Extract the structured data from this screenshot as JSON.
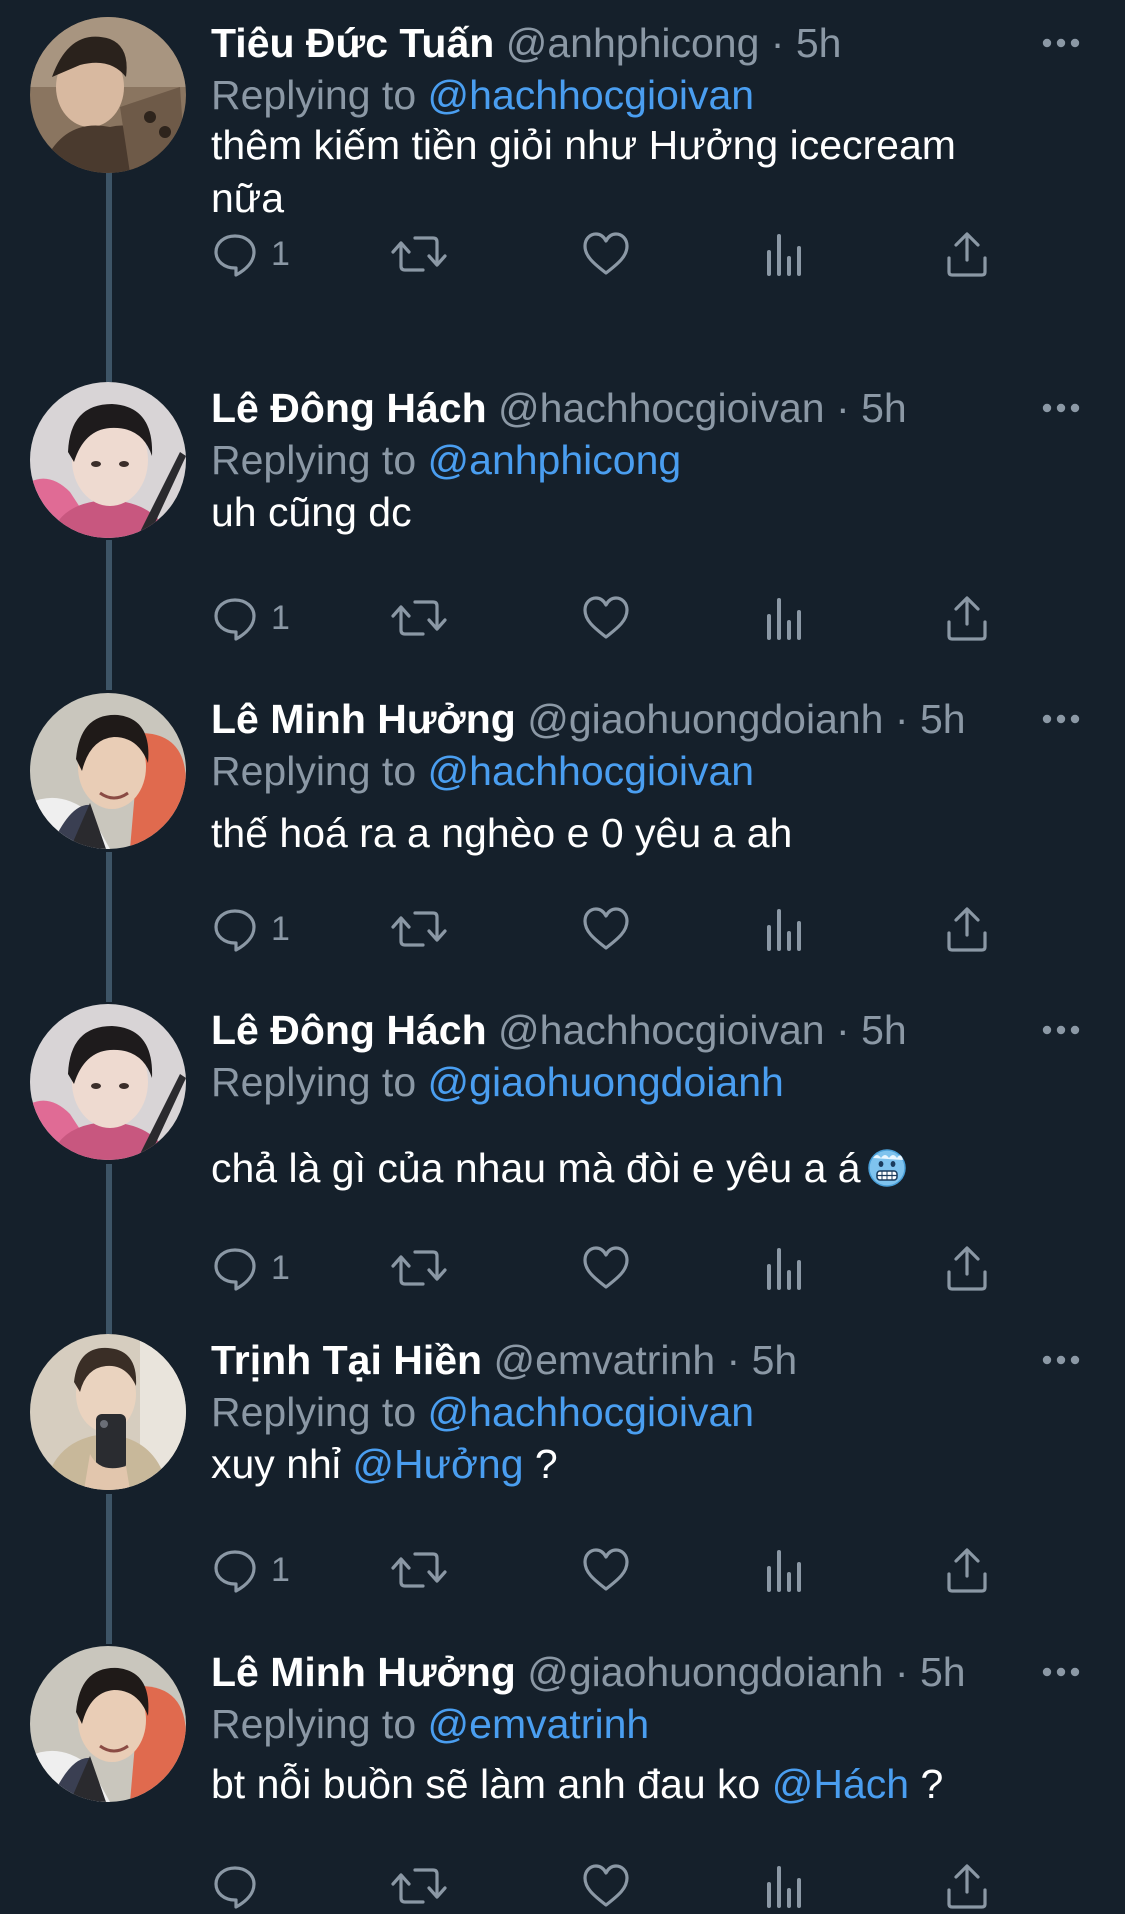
{
  "tweets": [
    {
      "name": "Tiêu Đức Tuấn",
      "handle": "@anhphicong",
      "sep": "·",
      "time": "5h",
      "replying_label": "Replying to",
      "replying_to": "@hachhocgioivan",
      "text_line1": "thêm kiếm tiền giỏi như Hưởng icecream",
      "text_line2": "nữa",
      "reply_count": "1"
    },
    {
      "name": "Lê Đông Hách",
      "handle": "@hachhocgioivan",
      "sep": "·",
      "time": "5h",
      "replying_label": "Replying to",
      "replying_to": "@anhphicong",
      "text": "uh cũng dc",
      "reply_count": "1"
    },
    {
      "name": "Lê Minh Hưởng",
      "handle": "@giaohuongdoianh",
      "sep": "·",
      "time": "5h",
      "replying_label": "Replying to",
      "replying_to": "@hachhocgioivan",
      "text": "thế hoá ra a nghèo e 0 yêu a ah",
      "reply_count": "1"
    },
    {
      "name": "Lê Đông Hách",
      "handle": "@hachhocgioivan",
      "sep": "·",
      "time": "5h",
      "replying_label": "Replying to",
      "replying_to": "@giaohuongdoianh",
      "text": "chả là gì của nhau mà đòi e yêu a á",
      "emoji": "cold-face-emoji",
      "reply_count": "1"
    },
    {
      "name": "Trịnh Tại Hiền",
      "handle": "@emvatrinh",
      "sep": "·",
      "time": "5h",
      "replying_label": "Replying to",
      "replying_to": "@hachhocgioivan",
      "text_before": "xuy nhỉ",
      "mention": "@Hưởng",
      "text_after": "?",
      "reply_count": "1"
    },
    {
      "name": "Lê Minh Hưởng",
      "handle": "@giaohuongdoianh",
      "sep": "·",
      "time": "5h",
      "replying_label": "Replying to",
      "replying_to": "@emvatrinh",
      "text_before": "bt nỗi buồn sẽ làm anh đau ko",
      "mention": "@Hách",
      "text_after": "?"
    }
  ],
  "icons": {
    "reply": "reply-icon",
    "retweet": "retweet-icon",
    "like": "like-icon",
    "analytics": "analytics-icon",
    "share": "share-icon",
    "more": "more-icon"
  },
  "colors": {
    "background": "#15202b",
    "secondary_text": "#8b98a5",
    "link": "#4a9ef0",
    "thread_line": "#3d5466"
  }
}
